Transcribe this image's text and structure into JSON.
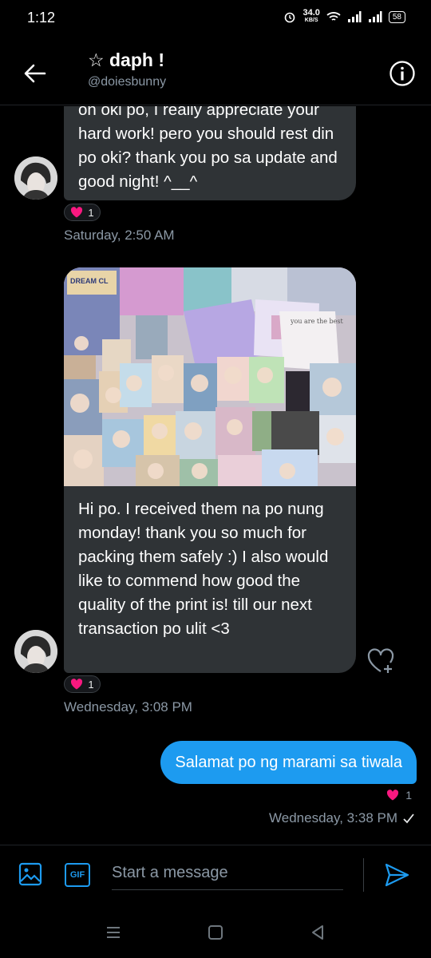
{
  "status": {
    "time": "1:12",
    "speed": "34.0",
    "speed_unit": "KB/S",
    "battery": "58"
  },
  "header": {
    "name": "☆ daph !",
    "handle": "@doiesbunny"
  },
  "messages": {
    "first_text": "on oki po, I really appreciate your hard work! pero you should rest din po oki? thank you po sa update and good night!  ^__^",
    "first_reaction_count": "1",
    "first_time": "Saturday, 2:50 AM",
    "second_text": "Hi po. I received them na po nung monday! thank you so much for packing them safely :) I also would like to commend how good the quality of the print is! till our next transaction po ulit <3",
    "second_reaction_count": "1",
    "second_time": "Wednesday, 3:08 PM",
    "outgoing_text": "Salamat po ng marami sa tiwala",
    "outgoing_reaction_count": "1",
    "outgoing_time": "Wednesday, 3:38 PM"
  },
  "photo_labels": {
    "top_left": "DREAM CL",
    "envelope": "you are the best"
  },
  "composer": {
    "placeholder": "Start a message",
    "gif_label": "GIF"
  },
  "colors": {
    "accent": "#1d9bf0",
    "bubble_in": "#2f3336",
    "heart": "#f91880",
    "muted": "#8b98a5"
  }
}
